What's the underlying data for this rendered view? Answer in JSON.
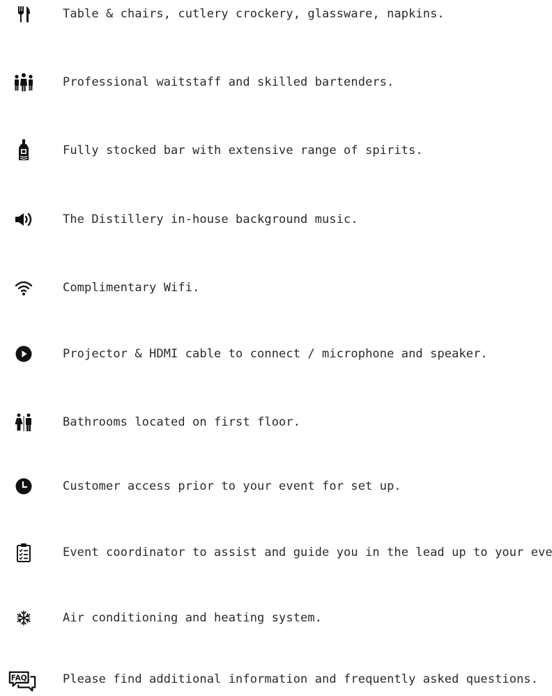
{
  "features": [
    {
      "icon": "cutlery-icon",
      "text": "Table & chairs, cutlery crockery, glassware, napkins."
    },
    {
      "icon": "staff-icon",
      "text": "Professional waitstaff and skilled bartenders."
    },
    {
      "icon": "bottle-icon",
      "text": "Fully stocked bar with extensive range of spirits."
    },
    {
      "icon": "speaker-icon",
      "text": "The Distillery in-house background music."
    },
    {
      "icon": "wifi-icon",
      "text": "Complimentary Wifi."
    },
    {
      "icon": "play-icon",
      "text": "Projector & HDMI cable to connect / microphone and speaker."
    },
    {
      "icon": "restroom-icon",
      "text": "Bathrooms located on first floor."
    },
    {
      "icon": "clock-icon",
      "text": "Customer access prior to your event for set up."
    },
    {
      "icon": "clipboard-icon",
      "text": "Event coordinator to assist and guide you in the lead up to your event."
    },
    {
      "icon": "snowflake-icon",
      "text": "Air conditioning and heating system."
    },
    {
      "icon": "faq-icon",
      "text": "Please find additional information and frequently asked questions."
    }
  ]
}
